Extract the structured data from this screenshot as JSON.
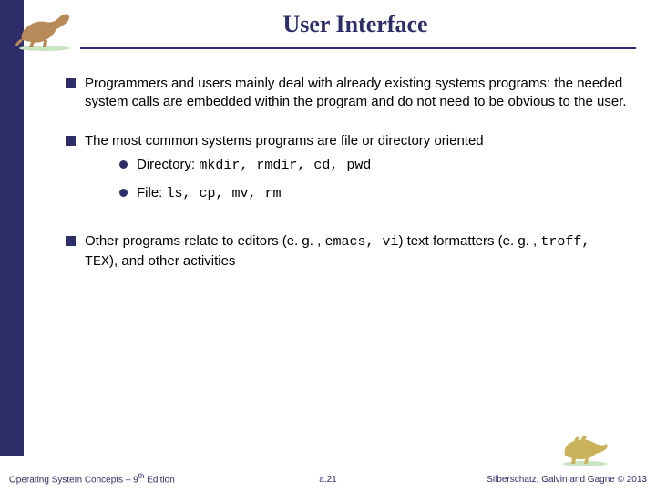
{
  "title": "User Interface",
  "bullets": [
    {
      "text": "Programmers and users mainly deal with already existing systems programs: the needed system calls are embedded within the program and do not need to be obvious to the user."
    },
    {
      "text": "The most common systems programs are file or directory oriented",
      "sub": [
        {
          "label": "Directory:",
          "cmds": "mkdir, rmdir, cd, pwd"
        },
        {
          "label": "File:",
          "cmds": "ls, cp, mv, rm"
        }
      ]
    },
    {
      "parts": {
        "a": "Other programs relate to editors (e. g. , ",
        "b": "emacs, vi",
        "c": ") text formatters (e. g. , ",
        "d": "troff, TEX",
        "e": "), and other activities"
      }
    }
  ],
  "footer": {
    "left_a": "Operating System Concepts – 9",
    "left_sup": "th",
    "left_b": " Edition",
    "center": "a.21",
    "right": "Silberschatz, Galvin and Gagne © 2013"
  },
  "icons": {
    "top": "dinosaur-running",
    "bottom": "dinosaur-grazing"
  }
}
